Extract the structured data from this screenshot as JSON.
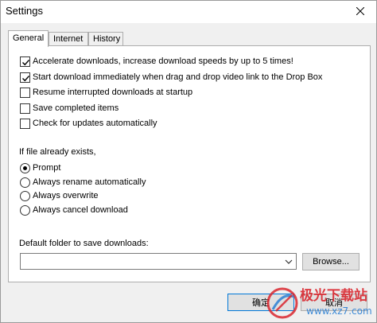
{
  "window": {
    "title": "Settings"
  },
  "tabs": [
    {
      "label": "General",
      "active": true
    },
    {
      "label": "Internet",
      "active": false
    },
    {
      "label": "History",
      "active": false
    }
  ],
  "options": [
    {
      "label": "Accelerate downloads, increase download speeds by up to 5 times!",
      "checked": true
    },
    {
      "label": "Start download immediately when drag and drop video link to the Drop Box",
      "checked": true
    },
    {
      "label": "Resume interrupted downloads at startup",
      "checked": false
    },
    {
      "label": "Save completed items",
      "checked": false
    },
    {
      "label": "Check for updates automatically",
      "checked": false
    }
  ],
  "file_exists": {
    "heading": "If file already exists,",
    "choices": [
      {
        "label": "Prompt",
        "selected": true
      },
      {
        "label": "Always rename automatically",
        "selected": false
      },
      {
        "label": "Always overwrite",
        "selected": false
      },
      {
        "label": "Always cancel download",
        "selected": false
      }
    ]
  },
  "folder": {
    "label": "Default folder to save downloads:",
    "value": "",
    "browse_label": "Browse..."
  },
  "buttons": {
    "ok_label": "确定",
    "cancel_label": "取消"
  },
  "watermark": {
    "text": "极光下载站",
    "url": "www.xz7.com"
  },
  "colors": {
    "accent": "#0078d7",
    "watermark_red": "#d9262e"
  }
}
